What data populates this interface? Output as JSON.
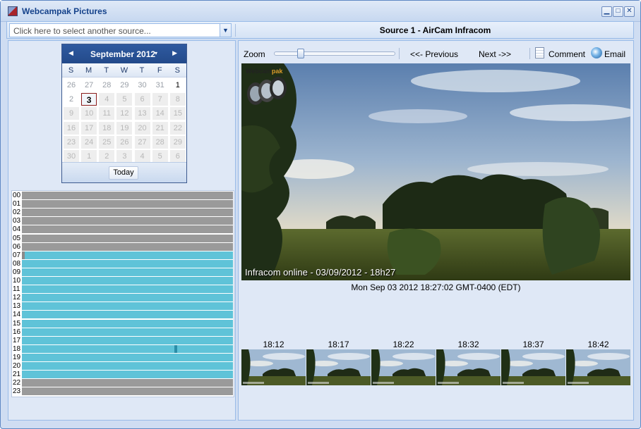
{
  "window": {
    "title": "Webcampak Pictures",
    "min_symbol": "▁",
    "max_symbol": "□",
    "close_symbol": "✕"
  },
  "source": {
    "placeholder": "Click here to select another source...",
    "title": "Source 1 - AirCam Infracom"
  },
  "calendar": {
    "month_label": "September 2012",
    "prev_symbol": "◀",
    "next_symbol": "▶",
    "menu_symbol": "▾",
    "days_of_week": [
      "S",
      "M",
      "T",
      "W",
      "T",
      "F",
      "S"
    ],
    "weeks": [
      [
        "26",
        "27",
        "28",
        "29",
        "30",
        "31",
        "1"
      ],
      [
        "2",
        "3",
        "4",
        "5",
        "6",
        "7",
        "8"
      ],
      [
        "9",
        "10",
        "11",
        "12",
        "13",
        "14",
        "15"
      ],
      [
        "16",
        "17",
        "18",
        "19",
        "20",
        "21",
        "22"
      ],
      [
        "23",
        "24",
        "25",
        "26",
        "27",
        "28",
        "29"
      ],
      [
        "30",
        "1",
        "2",
        "3",
        "4",
        "5",
        "6"
      ]
    ],
    "selected_day": "3",
    "today_label": "Today"
  },
  "timeline": {
    "hours": [
      "00",
      "01",
      "02",
      "03",
      "04",
      "05",
      "06",
      "07",
      "08",
      "09",
      "10",
      "11",
      "12",
      "13",
      "14",
      "15",
      "16",
      "17",
      "18",
      "19",
      "20",
      "21",
      "22",
      "23"
    ],
    "active_hours": [
      "07",
      "08",
      "09",
      "10",
      "11",
      "12",
      "13",
      "14",
      "15",
      "16",
      "17",
      "18",
      "19",
      "20",
      "21"
    ],
    "markers": [
      {
        "hour": "07",
        "minute": 0,
        "color": "#8a8a8a"
      },
      {
        "hour": "18",
        "minute": 44,
        "color": "#2a8ea8"
      }
    ]
  },
  "viewer": {
    "zoom_label": "Zoom",
    "zoom_level": 0.2,
    "previous_label": "<<- Previous",
    "next_label": "Next ->>",
    "comment_label": "Comment",
    "email_label": "Email",
    "logo_text": "Webcam",
    "logo_accent": "pak",
    "overlay_text": "Infracom online - 03/09/2012 - 18h27",
    "timestamp": "Mon Sep 03 2012 18:27:02 GMT-0400 (EDT)"
  },
  "thumbnails": [
    "18:12",
    "18:17",
    "18:22",
    "18:32",
    "18:37",
    "18:42"
  ],
  "colors": {
    "brand": "#15428b",
    "active_hour": "#5fc3d8",
    "inactive_hour": "#9a9a9a",
    "selected_day_border": "#8b1a1a"
  }
}
